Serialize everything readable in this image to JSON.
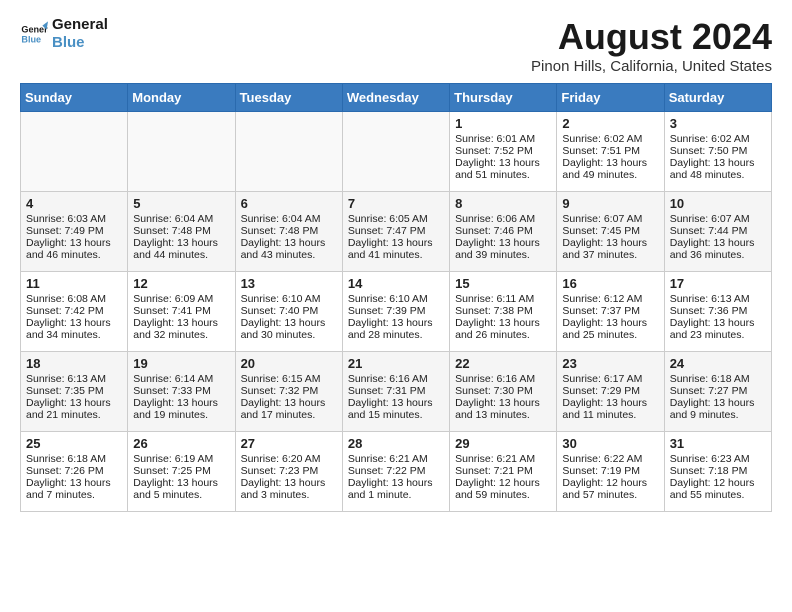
{
  "header": {
    "logo_line1": "General",
    "logo_line2": "Blue",
    "month_year": "August 2024",
    "location": "Pinon Hills, California, United States"
  },
  "weekdays": [
    "Sunday",
    "Monday",
    "Tuesday",
    "Wednesday",
    "Thursday",
    "Friday",
    "Saturday"
  ],
  "weeks": [
    [
      {
        "day": "",
        "data": ""
      },
      {
        "day": "",
        "data": ""
      },
      {
        "day": "",
        "data": ""
      },
      {
        "day": "",
        "data": ""
      },
      {
        "day": "1",
        "data": "Sunrise: 6:01 AM\nSunset: 7:52 PM\nDaylight: 13 hours and 51 minutes."
      },
      {
        "day": "2",
        "data": "Sunrise: 6:02 AM\nSunset: 7:51 PM\nDaylight: 13 hours and 49 minutes."
      },
      {
        "day": "3",
        "data": "Sunrise: 6:02 AM\nSunset: 7:50 PM\nDaylight: 13 hours and 48 minutes."
      }
    ],
    [
      {
        "day": "4",
        "data": "Sunrise: 6:03 AM\nSunset: 7:49 PM\nDaylight: 13 hours and 46 minutes."
      },
      {
        "day": "5",
        "data": "Sunrise: 6:04 AM\nSunset: 7:48 PM\nDaylight: 13 hours and 44 minutes."
      },
      {
        "day": "6",
        "data": "Sunrise: 6:04 AM\nSunset: 7:48 PM\nDaylight: 13 hours and 43 minutes."
      },
      {
        "day": "7",
        "data": "Sunrise: 6:05 AM\nSunset: 7:47 PM\nDaylight: 13 hours and 41 minutes."
      },
      {
        "day": "8",
        "data": "Sunrise: 6:06 AM\nSunset: 7:46 PM\nDaylight: 13 hours and 39 minutes."
      },
      {
        "day": "9",
        "data": "Sunrise: 6:07 AM\nSunset: 7:45 PM\nDaylight: 13 hours and 37 minutes."
      },
      {
        "day": "10",
        "data": "Sunrise: 6:07 AM\nSunset: 7:44 PM\nDaylight: 13 hours and 36 minutes."
      }
    ],
    [
      {
        "day": "11",
        "data": "Sunrise: 6:08 AM\nSunset: 7:42 PM\nDaylight: 13 hours and 34 minutes."
      },
      {
        "day": "12",
        "data": "Sunrise: 6:09 AM\nSunset: 7:41 PM\nDaylight: 13 hours and 32 minutes."
      },
      {
        "day": "13",
        "data": "Sunrise: 6:10 AM\nSunset: 7:40 PM\nDaylight: 13 hours and 30 minutes."
      },
      {
        "day": "14",
        "data": "Sunrise: 6:10 AM\nSunset: 7:39 PM\nDaylight: 13 hours and 28 minutes."
      },
      {
        "day": "15",
        "data": "Sunrise: 6:11 AM\nSunset: 7:38 PM\nDaylight: 13 hours and 26 minutes."
      },
      {
        "day": "16",
        "data": "Sunrise: 6:12 AM\nSunset: 7:37 PM\nDaylight: 13 hours and 25 minutes."
      },
      {
        "day": "17",
        "data": "Sunrise: 6:13 AM\nSunset: 7:36 PM\nDaylight: 13 hours and 23 minutes."
      }
    ],
    [
      {
        "day": "18",
        "data": "Sunrise: 6:13 AM\nSunset: 7:35 PM\nDaylight: 13 hours and 21 minutes."
      },
      {
        "day": "19",
        "data": "Sunrise: 6:14 AM\nSunset: 7:33 PM\nDaylight: 13 hours and 19 minutes."
      },
      {
        "day": "20",
        "data": "Sunrise: 6:15 AM\nSunset: 7:32 PM\nDaylight: 13 hours and 17 minutes."
      },
      {
        "day": "21",
        "data": "Sunrise: 6:16 AM\nSunset: 7:31 PM\nDaylight: 13 hours and 15 minutes."
      },
      {
        "day": "22",
        "data": "Sunrise: 6:16 AM\nSunset: 7:30 PM\nDaylight: 13 hours and 13 minutes."
      },
      {
        "day": "23",
        "data": "Sunrise: 6:17 AM\nSunset: 7:29 PM\nDaylight: 13 hours and 11 minutes."
      },
      {
        "day": "24",
        "data": "Sunrise: 6:18 AM\nSunset: 7:27 PM\nDaylight: 13 hours and 9 minutes."
      }
    ],
    [
      {
        "day": "25",
        "data": "Sunrise: 6:18 AM\nSunset: 7:26 PM\nDaylight: 13 hours and 7 minutes."
      },
      {
        "day": "26",
        "data": "Sunrise: 6:19 AM\nSunset: 7:25 PM\nDaylight: 13 hours and 5 minutes."
      },
      {
        "day": "27",
        "data": "Sunrise: 6:20 AM\nSunset: 7:23 PM\nDaylight: 13 hours and 3 minutes."
      },
      {
        "day": "28",
        "data": "Sunrise: 6:21 AM\nSunset: 7:22 PM\nDaylight: 13 hours and 1 minute."
      },
      {
        "day": "29",
        "data": "Sunrise: 6:21 AM\nSunset: 7:21 PM\nDaylight: 12 hours and 59 minutes."
      },
      {
        "day": "30",
        "data": "Sunrise: 6:22 AM\nSunset: 7:19 PM\nDaylight: 12 hours and 57 minutes."
      },
      {
        "day": "31",
        "data": "Sunrise: 6:23 AM\nSunset: 7:18 PM\nDaylight: 12 hours and 55 minutes."
      }
    ]
  ]
}
